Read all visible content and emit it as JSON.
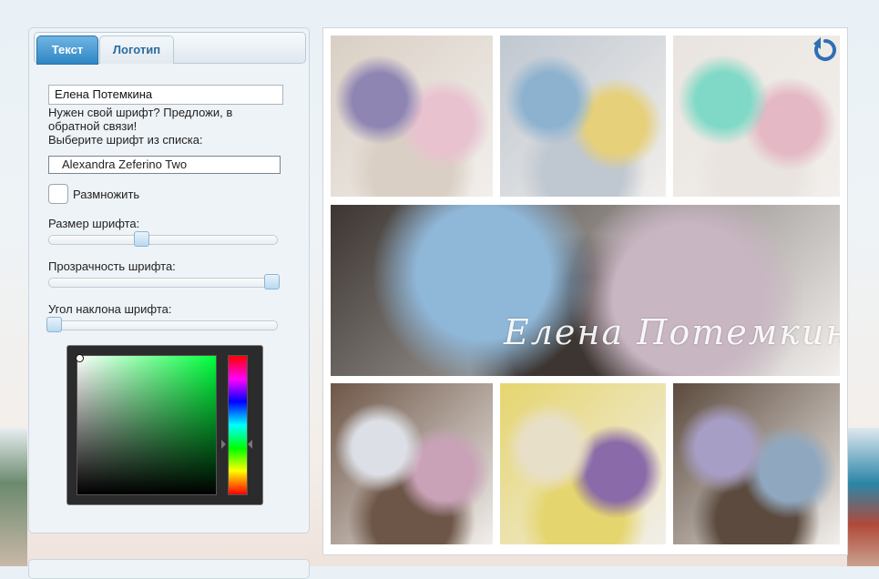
{
  "tabs": [
    {
      "label": "Текст",
      "active": true
    },
    {
      "label": "Логотип",
      "active": false
    }
  ],
  "text_field": {
    "value": "Елена Потемкина"
  },
  "font_hint": "Нужен свой шрифт? Предложи, в обратной связи!",
  "font_select_prompt": "Выберите шрифт из списка:",
  "font_select": {
    "selected": "Alexandra Zeferino Two"
  },
  "multiply": {
    "label": "Размножить",
    "checked": false
  },
  "sliders": [
    {
      "label": "Размер шрифта:",
      "value": 0.4
    },
    {
      "label": "Прозрачность шрифта:",
      "value": 1.0
    },
    {
      "label": "Угол наклона шрифта:",
      "value": 0.0
    }
  ],
  "color_picker": {
    "hue_color": "#00ff3c",
    "selected_color": "#ffffff"
  },
  "gallery": {
    "watermark_text": "Елена Потемкина",
    "redo_icon": "redo-icon",
    "photos": [
      {
        "name": "photo-purple-pink-roses",
        "palette": [
          "#8f85b3",
          "#e8c2cf",
          "#d9cfc4"
        ]
      },
      {
        "name": "photo-blue-yellow-lilies",
        "palette": [
          "#8db2cf",
          "#e6d07a",
          "#bfc7d0"
        ]
      },
      {
        "name": "photo-mint-roses",
        "palette": [
          "#7fd9c6",
          "#e4b8c4",
          "#e9e4df"
        ]
      },
      {
        "name": "photo-banner-roses",
        "palette": [
          "#8fb7d8",
          "#c9b6c3",
          "#3c3531"
        ]
      },
      {
        "name": "photo-necklace",
        "palette": [
          "#dcdfe6",
          "#c9a2b8",
          "#6d5647"
        ]
      },
      {
        "name": "photo-white-orchids",
        "palette": [
          "#e8dfc9",
          "#8a6aa8",
          "#e5d56e"
        ]
      },
      {
        "name": "photo-lilac-roses",
        "palette": [
          "#a79ec6",
          "#8fa8c0",
          "#5b4a3d"
        ]
      }
    ]
  }
}
